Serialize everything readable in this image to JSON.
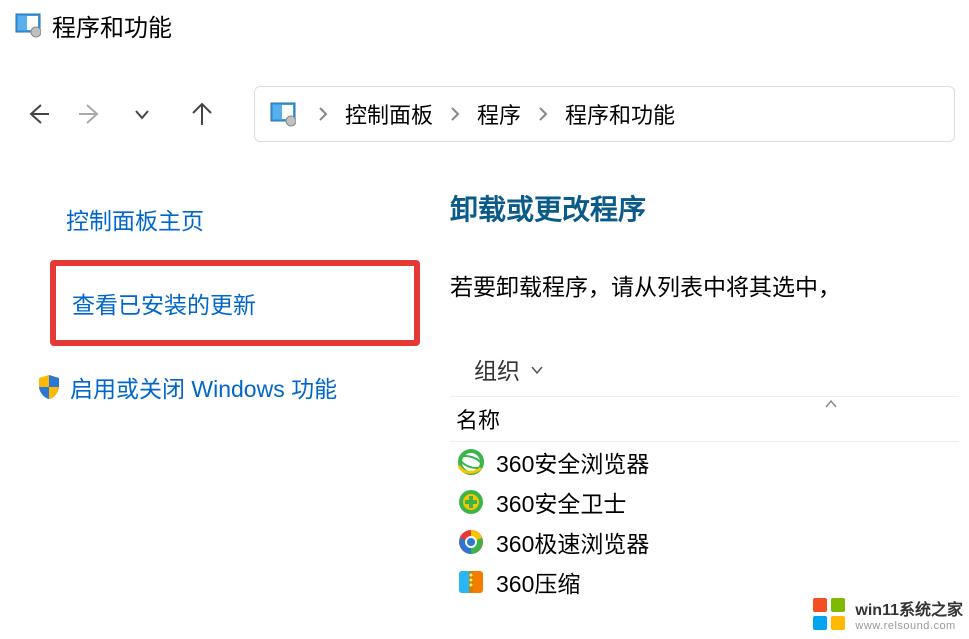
{
  "window": {
    "title": "程序和功能"
  },
  "breadcrumb": {
    "parts": [
      "控制面板",
      "程序",
      "程序和功能"
    ]
  },
  "sidebar": {
    "home": "控制面板主页",
    "view_updates": "查看已安装的更新",
    "windows_features": "启用或关闭 Windows 功能"
  },
  "main": {
    "heading": "卸载或更改程序",
    "description": "若要卸载程序，请从列表中将其选中，",
    "organize": "组织",
    "column_name": "名称"
  },
  "programs": [
    {
      "name": "360安全浏览器",
      "icon": "ie-green"
    },
    {
      "name": "360安全卫士",
      "icon": "360-shield"
    },
    {
      "name": "360极速浏览器",
      "icon": "chrome-color"
    },
    {
      "name": "360压缩",
      "icon": "zip-orange"
    }
  ],
  "watermark": {
    "title": "win11系统之家",
    "url": "www.relsound.com"
  }
}
